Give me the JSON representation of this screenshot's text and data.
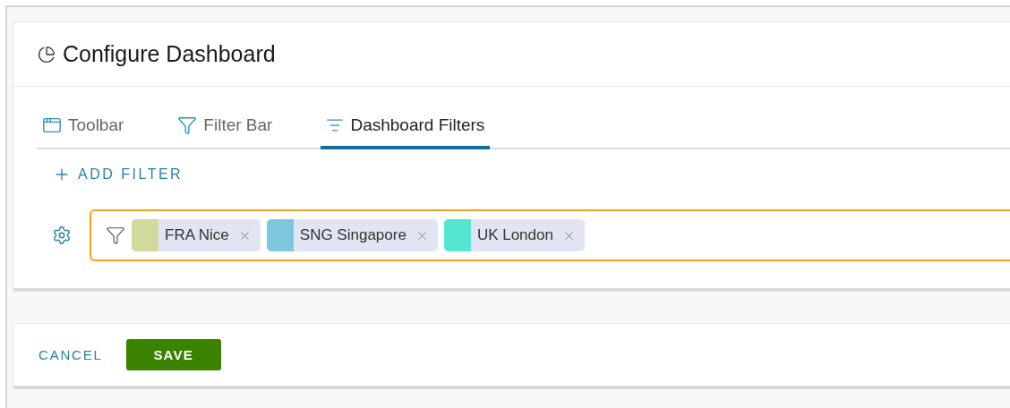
{
  "dialog": {
    "title": "Configure Dashboard"
  },
  "tabs": [
    {
      "label": "Toolbar",
      "selected": false
    },
    {
      "label": "Filter Bar",
      "selected": false
    },
    {
      "label": "Dashboard Filters",
      "selected": true
    }
  ],
  "add_filter": "ADD FILTER",
  "filter_field": {
    "focused": true,
    "chips": [
      {
        "label": "FRA Nice",
        "color": "#d3d99a"
      },
      {
        "label": "SNG Singapore",
        "color": "#7ec8dd"
      },
      {
        "label": "UK London",
        "color": "#55e6d1"
      }
    ]
  },
  "buttons": {
    "cancel": "CANCEL",
    "save": "SAVE"
  }
}
